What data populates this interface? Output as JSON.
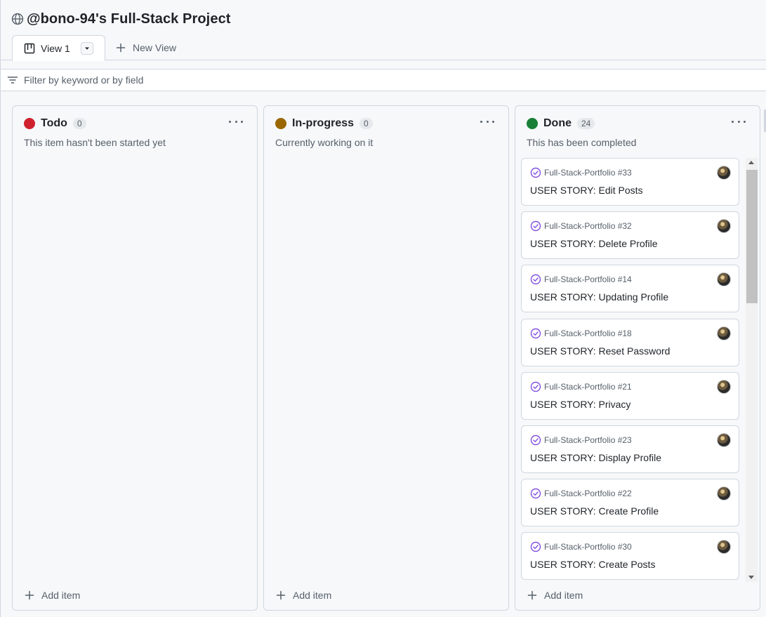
{
  "header": {
    "title": "@bono-94's Full-Stack Project",
    "tabs": [
      {
        "label": "View 1",
        "icon": "board-icon",
        "active": true
      }
    ],
    "new_view_label": "New View"
  },
  "filter": {
    "placeholder": "Filter by keyword or by field",
    "value": ""
  },
  "columns": [
    {
      "name": "Todo",
      "count": "0",
      "description": "This item hasn't been started yet",
      "color": "#cf222e"
    },
    {
      "name": "In-progress",
      "count": "0",
      "description": "Currently working on it",
      "color": "#9a6700"
    },
    {
      "name": "Done",
      "count": "24",
      "description": "This has been completed",
      "color": "#1a7f37"
    }
  ],
  "add_item_label": "Add item",
  "done_cards": [
    {
      "ref": "Full-Stack-Portfolio #33",
      "title": "USER STORY: Edit Posts"
    },
    {
      "ref": "Full-Stack-Portfolio #32",
      "title": "USER STORY: Delete Profile"
    },
    {
      "ref": "Full-Stack-Portfolio #14",
      "title": "USER STORY: Updating Profile"
    },
    {
      "ref": "Full-Stack-Portfolio #18",
      "title": "USER STORY: Reset Password"
    },
    {
      "ref": "Full-Stack-Portfolio #21",
      "title": "USER STORY: Privacy"
    },
    {
      "ref": "Full-Stack-Portfolio #23",
      "title": "USER STORY: Display Profile"
    },
    {
      "ref": "Full-Stack-Portfolio #22",
      "title": "USER STORY: Create Profile"
    },
    {
      "ref": "Full-Stack-Portfolio #30",
      "title": "USER STORY: Create Posts"
    }
  ],
  "colors": {
    "closed_issue": "#8250df",
    "border": "#d0d7de",
    "muted_text": "#57606a"
  }
}
